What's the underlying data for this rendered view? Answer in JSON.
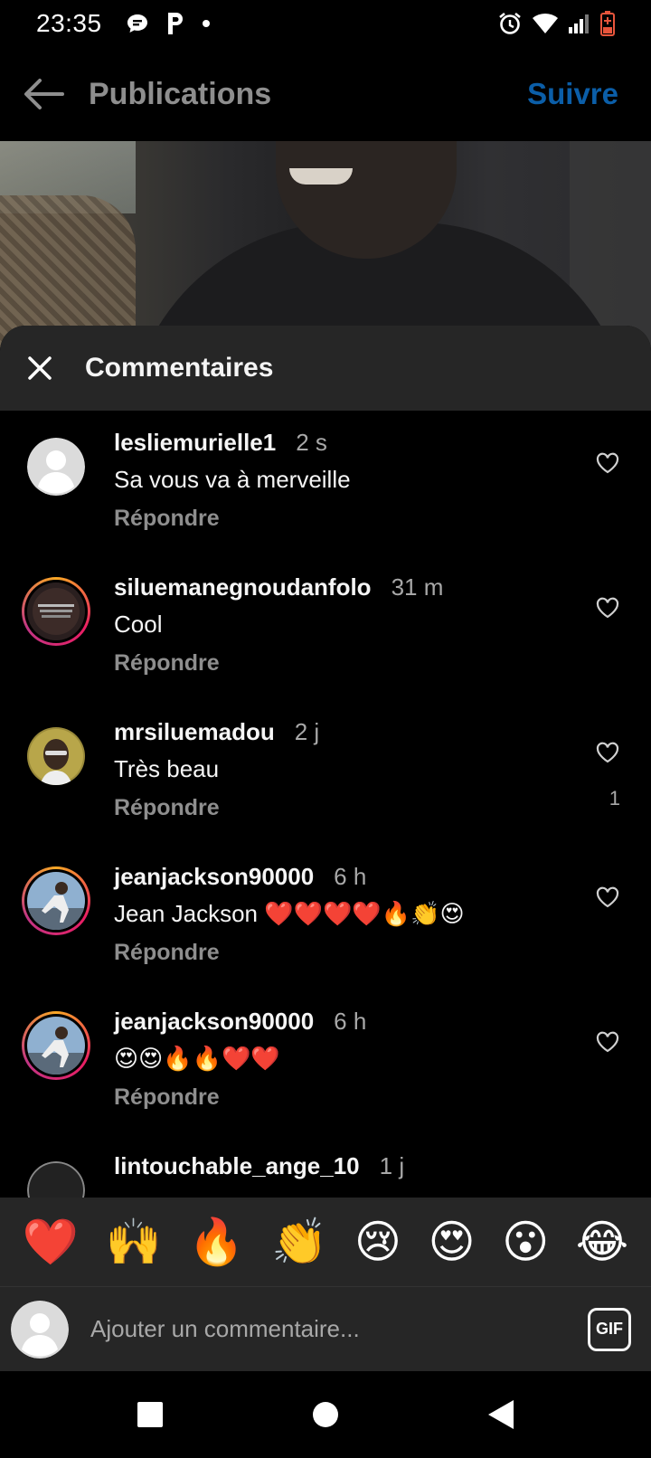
{
  "status_bar": {
    "time": "23:35",
    "left_icons": [
      "chat-bubble-icon",
      "parking-icon",
      "dot-icon"
    ],
    "right_icons": [
      "alarm-icon",
      "wifi-icon",
      "signal-icon",
      "battery-icon"
    ]
  },
  "header": {
    "title": "Publications",
    "follow_label": "Suivre",
    "accent_color": "#0b5ea8"
  },
  "comments_sheet": {
    "title": "Commentaires",
    "reply_label": "Répondre",
    "comments": [
      {
        "username": "lesliemurielle1",
        "time": "2 s",
        "text": "Sa vous va à merveille",
        "like_count": ""
      },
      {
        "username": "siluemanegnoudanfolo",
        "time": "31 m",
        "text": "Cool",
        "like_count": ""
      },
      {
        "username": "mrsiluemadou",
        "time": "2 j",
        "text": "Très beau",
        "like_count": "1"
      },
      {
        "username": "jeanjackson90000",
        "time": "6 h",
        "text": "Jean Jackson ❤️❤️❤️❤️🔥👏😍",
        "like_count": ""
      },
      {
        "username": "jeanjackson90000",
        "time": "6 h",
        "text": "😍😍🔥🔥❤️❤️",
        "like_count": ""
      },
      {
        "username": "lintouchable_ange_10",
        "time": "1 j",
        "text": "",
        "like_count": ""
      }
    ]
  },
  "emoji_bar": [
    "❤️",
    "🙌",
    "🔥",
    "👏",
    "😢",
    "😍",
    "😮",
    "😂"
  ],
  "comment_input": {
    "placeholder": "Ajouter un commentaire...",
    "gif_label": "GIF"
  }
}
